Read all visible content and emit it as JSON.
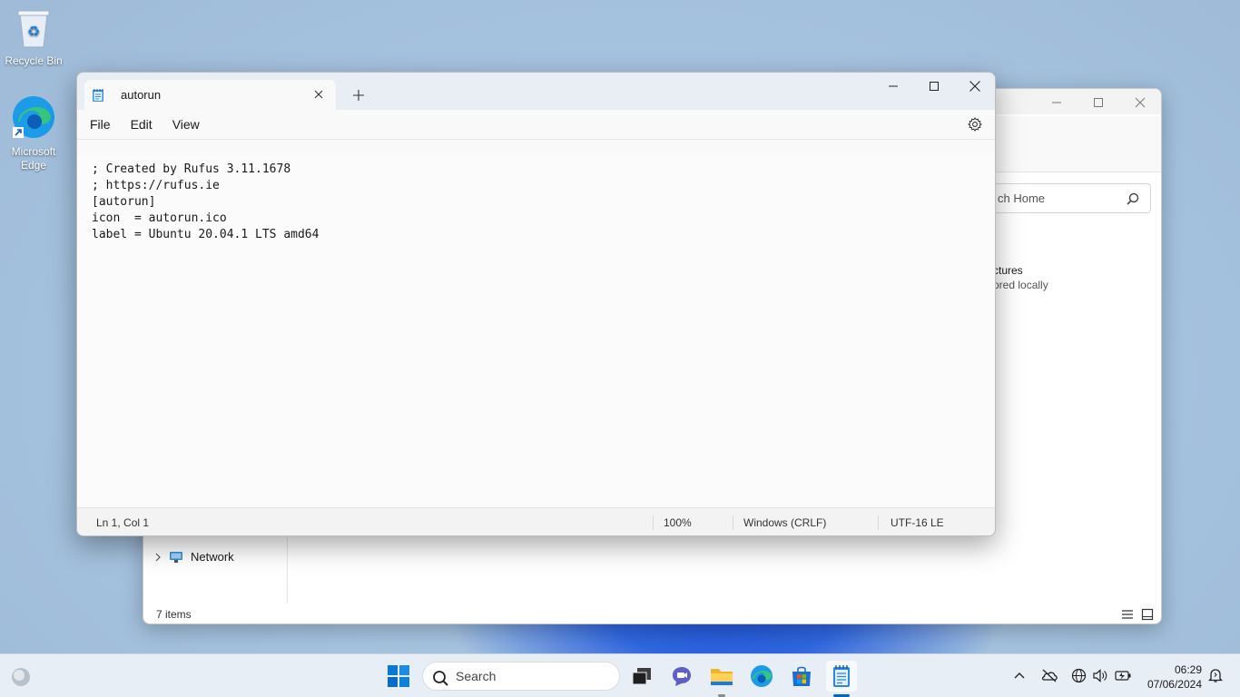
{
  "desktop": {
    "icons": [
      {
        "label": "Recycle Bin"
      },
      {
        "label": "Microsoft Edge"
      }
    ]
  },
  "explorer": {
    "search_placeholder": "ch Home",
    "pictures": {
      "title": "ctures",
      "subtitle": "ored locally"
    },
    "nav_network": "Network",
    "status_items": "7 items"
  },
  "notepad": {
    "tab_title": "autorun",
    "menu": [
      "File",
      "Edit",
      "View"
    ],
    "content": "; Created by Rufus 3.11.1678\n; https://rufus.ie\n[autorun]\nicon  = autorun.ico\nlabel = Ubuntu 20.04.1 LTS amd64",
    "status": {
      "position": "Ln 1, Col 1",
      "zoom": "100%",
      "line_ending": "Windows (CRLF)",
      "encoding": "UTF-16 LE"
    }
  },
  "taskbar": {
    "search_label": "Search",
    "clock": {
      "time": "06:29",
      "date": "07/06/2024"
    }
  },
  "colors": {
    "accent": "#0067c0",
    "notepad_titlebar": "#e9eef5",
    "taskbar": "#e8eef6"
  }
}
